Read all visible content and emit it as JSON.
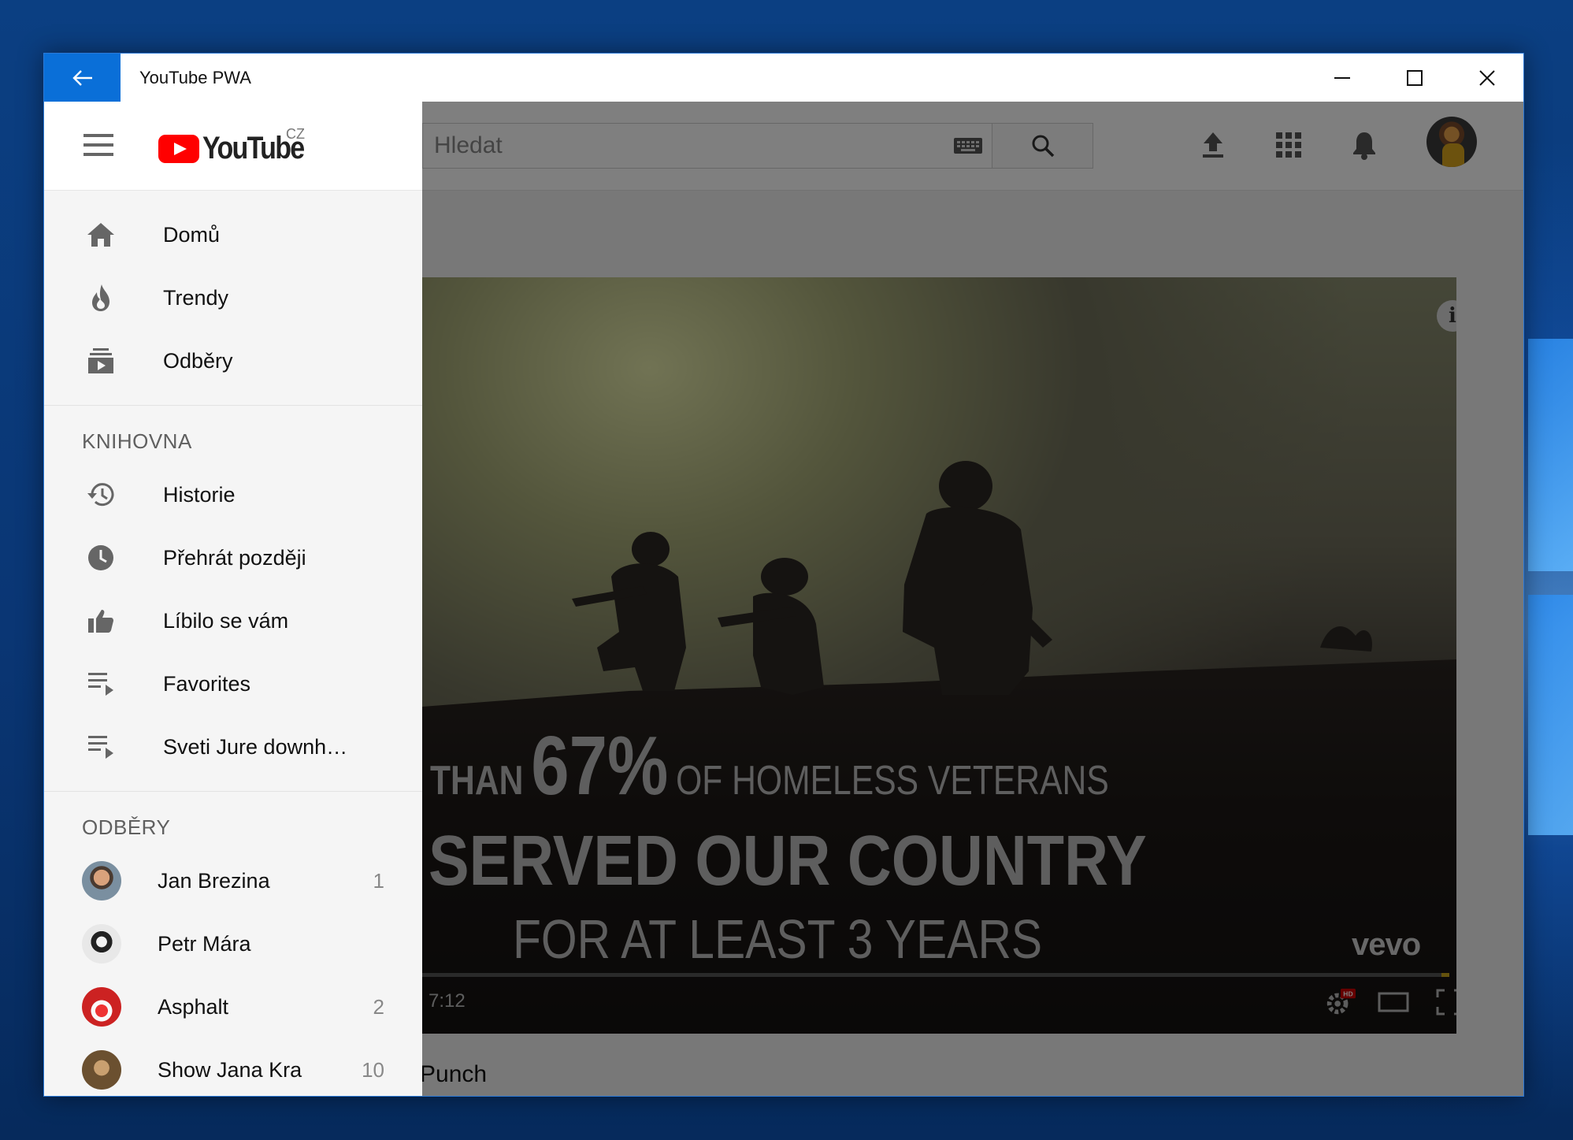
{
  "window": {
    "title": "YouTube PWA"
  },
  "header": {
    "logo_text": "YouTube",
    "logo_region": "CZ",
    "search_placeholder": "Hledat"
  },
  "sidebar": {
    "main_items": [
      {
        "label": "Domů",
        "icon": "home-icon"
      },
      {
        "label": "Trendy",
        "icon": "flame-icon"
      },
      {
        "label": "Odběry",
        "icon": "subscriptions-icon"
      }
    ],
    "library_title": "KNIHOVNA",
    "library_items": [
      {
        "label": "Historie",
        "icon": "history-icon"
      },
      {
        "label": "Přehrát později",
        "icon": "clock-icon"
      },
      {
        "label": "Líbilo se vám",
        "icon": "thumbs-up-icon"
      },
      {
        "label": "Favorites",
        "icon": "playlist-icon"
      },
      {
        "label": "Sveti Jure downh…",
        "icon": "playlist-icon"
      }
    ],
    "subscriptions_title": "ODBĚRY",
    "subscriptions": [
      {
        "name": "Jan Brezina",
        "count": "1"
      },
      {
        "name": "Petr Mára",
        "count": ""
      },
      {
        "name": "Asphalt",
        "count": "2"
      },
      {
        "name": "Show Jana Kra",
        "count": "10"
      }
    ]
  },
  "video": {
    "overlay_line1_prefix": "THAN",
    "overlay_line1_big": "67%",
    "overlay_line1_suffix": "OF HOMELESS VETERANS",
    "overlay_line2": "SERVED OUR COUNTRY",
    "overlay_line3": "FOR AT LEAST 3 YEARS",
    "watermark": "vevo",
    "time": "7:12",
    "info_glyph": "i",
    "hd_badge": "HD",
    "progress": 0.995,
    "title_partial": "Punch"
  },
  "colors": {
    "accent": "#0a6fd8",
    "youtube_red": "#ff0000"
  }
}
